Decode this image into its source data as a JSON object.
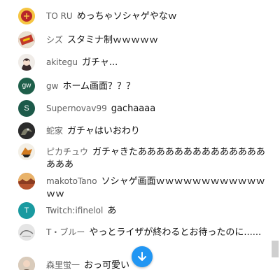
{
  "messages": [
    {
      "author": "TO RU",
      "text": "めっちゃソシャゲやなｗ",
      "avatar_icon": "red-ball-icon"
    },
    {
      "author": "シズ",
      "text": "スタミナ制ｗｗｗｗｗ",
      "avatar_icon": "box-art-icon"
    },
    {
      "author": "akitegu",
      "text": "ガチャ...",
      "avatar_icon": "anime-girl-icon"
    },
    {
      "author": "gw",
      "text": "ホーム画面？？？",
      "avatar_letter": "gw"
    },
    {
      "author": "Supernovav99",
      "text": "gachaaaa",
      "avatar_letter": "S"
    },
    {
      "author": "蛇家",
      "text": "ガチャはいおわり",
      "avatar_icon": "dark-creature-icon"
    },
    {
      "author": "ピカチュウ",
      "text": "ガチャきたあああああああああああああああああ",
      "avatar_icon": "fox-icon"
    },
    {
      "author": "makotoTano",
      "text": "ソシャゲ画面ｗｗｗｗｗｗｗｗｗｗｗｗｗｗ",
      "avatar_icon": "landscape-icon"
    },
    {
      "author": "Twitch:ifinelol",
      "text": "あ",
      "avatar_letter": "T"
    },
    {
      "author": "T・ブルー",
      "text": "やっとライザが終わるとお待ったのに......",
      "avatar_icon": "sketch-icon"
    },
    {
      "author": "森里蛍一",
      "text": "おっ可愛い",
      "avatar_icon": "person-photo-icon"
    }
  ],
  "colors": {
    "author": "#606060",
    "scroll_button": "#2196f3",
    "avatar_gw": "#1e5f4a",
    "avatar_S": "#1d5a4a",
    "avatar_T": "#1a9aa0"
  },
  "scroll_button_icon": "arrow-down-icon"
}
